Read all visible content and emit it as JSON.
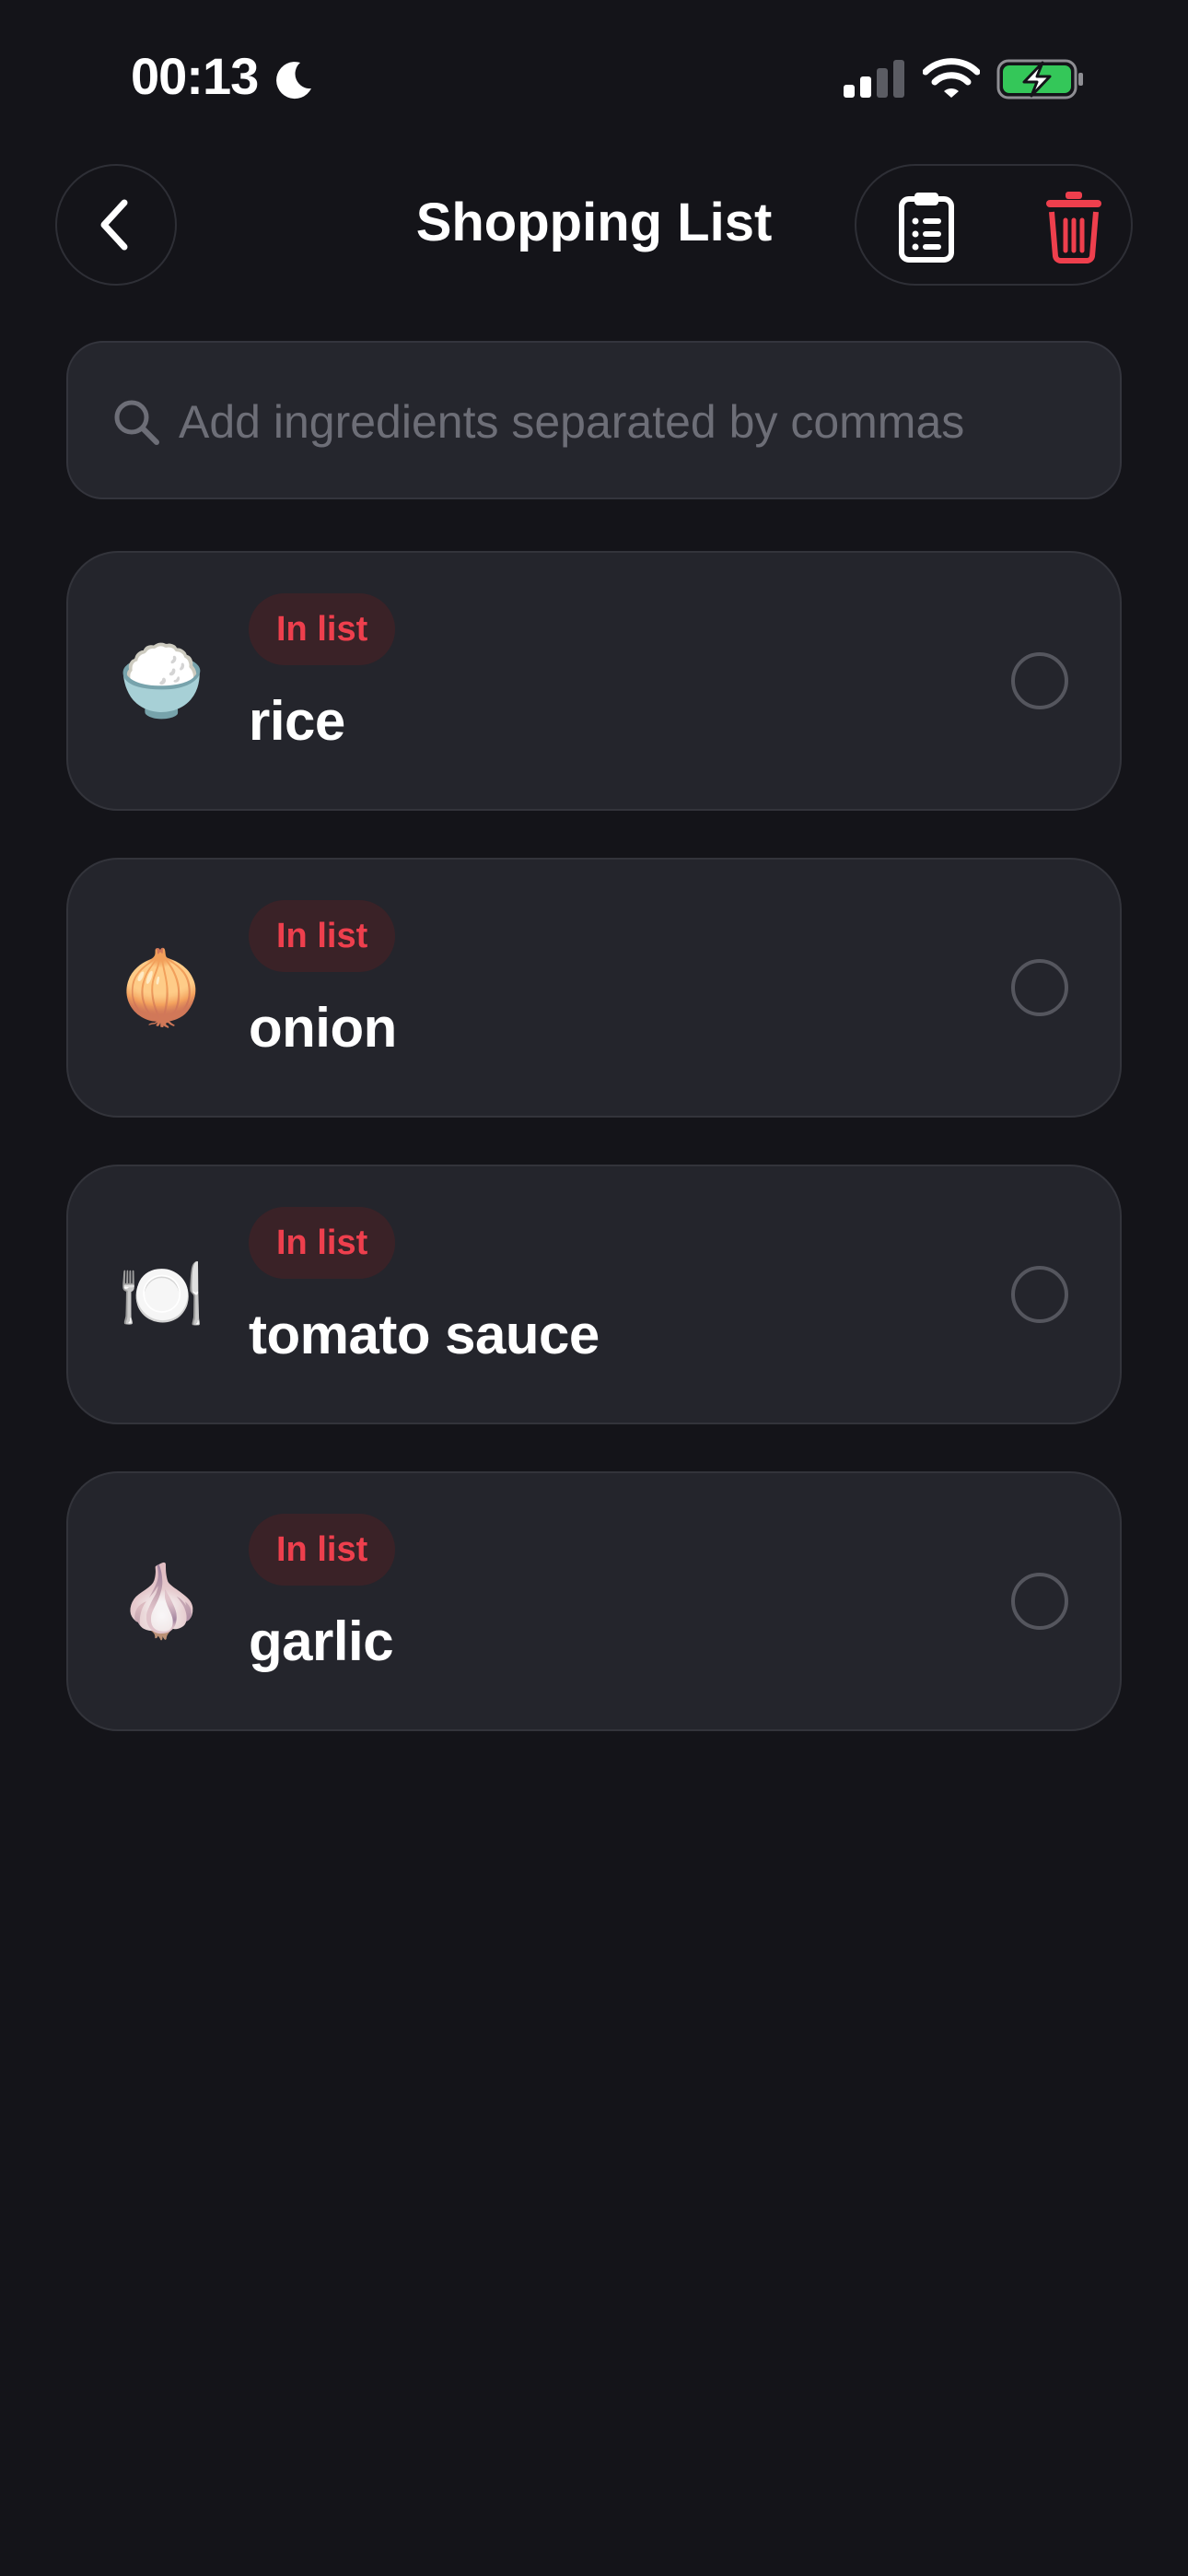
{
  "status_bar": {
    "time": "00:13",
    "icons": [
      "moon-icon",
      "signal-icon",
      "wifi-icon",
      "battery-charging-icon"
    ]
  },
  "header": {
    "title": "Shopping List",
    "back_icon": "chevron-left-icon",
    "actions": [
      "clipboard-list-icon",
      "trash-icon"
    ]
  },
  "search": {
    "placeholder": "Add ingredients separated by commas",
    "value": ""
  },
  "items": [
    {
      "emoji": "🍚",
      "status": "In list",
      "name": "rice",
      "checked": false
    },
    {
      "emoji": "🧅",
      "status": "In list",
      "name": "onion",
      "checked": false
    },
    {
      "emoji": "🍽️",
      "status": "In list",
      "name": "tomato sauce",
      "checked": false
    },
    {
      "emoji": "🧄",
      "status": "In list",
      "name": "garlic",
      "checked": false
    }
  ],
  "colors": {
    "background": "#141419",
    "card": "#24252c",
    "accent_red": "#ee3f4d",
    "pill_bg": "#3a2227",
    "battery_green": "#34c759"
  }
}
